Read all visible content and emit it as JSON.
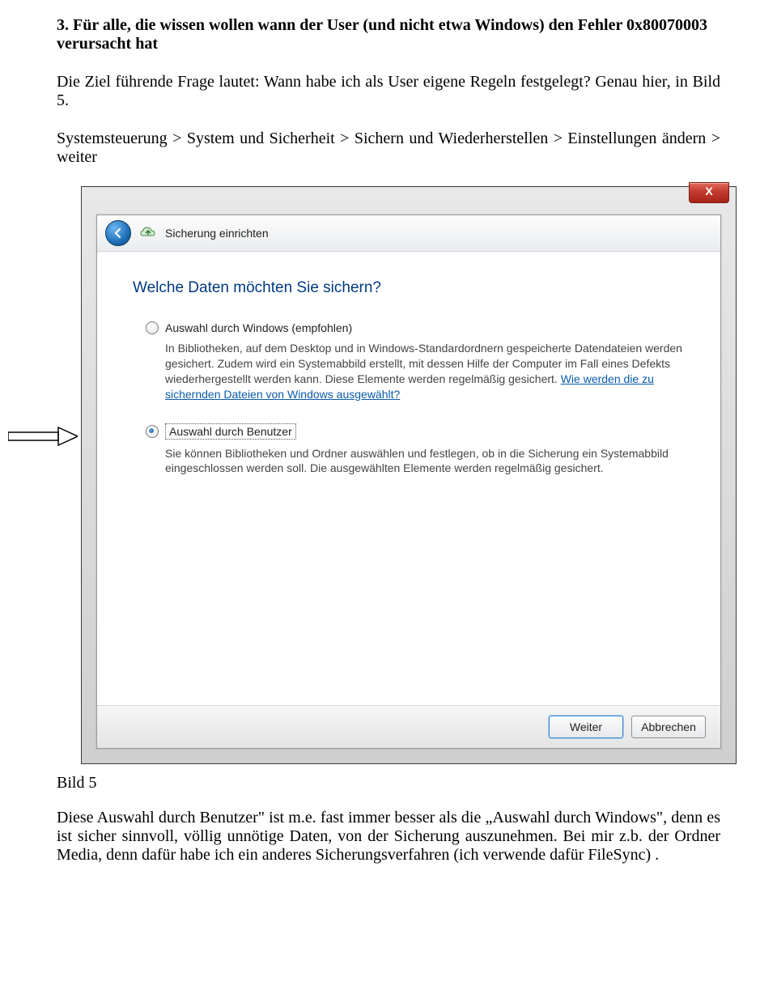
{
  "heading": "3. Für alle, die wissen wollen wann der User (und nicht etwa Windows) den Fehler 0x80070003 verursacht hat",
  "para1": "Die Ziel führende Frage lautet: Wann habe ich als User eigene Regeln festgelegt? Genau hier, in Bild 5.",
  "para2": "Systemsteuerung > System und Sicherheit > Sichern und Wiederherstellen > Einstellungen ändern > weiter",
  "caption": "Bild 5",
  "para3": "Diese Auswahl durch Benutzer\"   ist m.e. fast immer besser als die „Auswahl durch Windows\", denn es ist sicher sinnvoll, völlig unnötige Daten, von der Sicherung auszunehmen. Bei mir z.b. der Ordner Media, denn dafür habe ich ein anderes Sicherungsverfahren (ich verwende dafür FileSync) .",
  "screenshot": {
    "close_glyph": "X",
    "header_title": "Sicherung einrichten",
    "question": "Welche Daten möchten Sie sichern?",
    "opt1": {
      "label": "Auswahl durch Windows (empfohlen)",
      "desc_pre": "In Bibliotheken, auf dem Desktop und in Windows-Standardordnern gespeicherte Datendateien werden gesichert. Zudem wird ein Systemabbild erstellt, mit dessen Hilfe der Computer im Fall eines Defekts wiederhergestellt werden kann. Diese Elemente werden regelmäßig gesichert. ",
      "link": "Wie werden die zu sichernden Dateien von Windows ausgewählt?"
    },
    "opt2": {
      "label": "Auswahl durch Benutzer",
      "desc": "Sie können Bibliotheken und Ordner auswählen und festlegen, ob in die Sicherung ein Systemabbild eingeschlossen werden soll. Die ausgewählten Elemente werden regelmäßig gesichert."
    },
    "btn_next": "Weiter",
    "btn_cancel": "Abbrechen"
  }
}
